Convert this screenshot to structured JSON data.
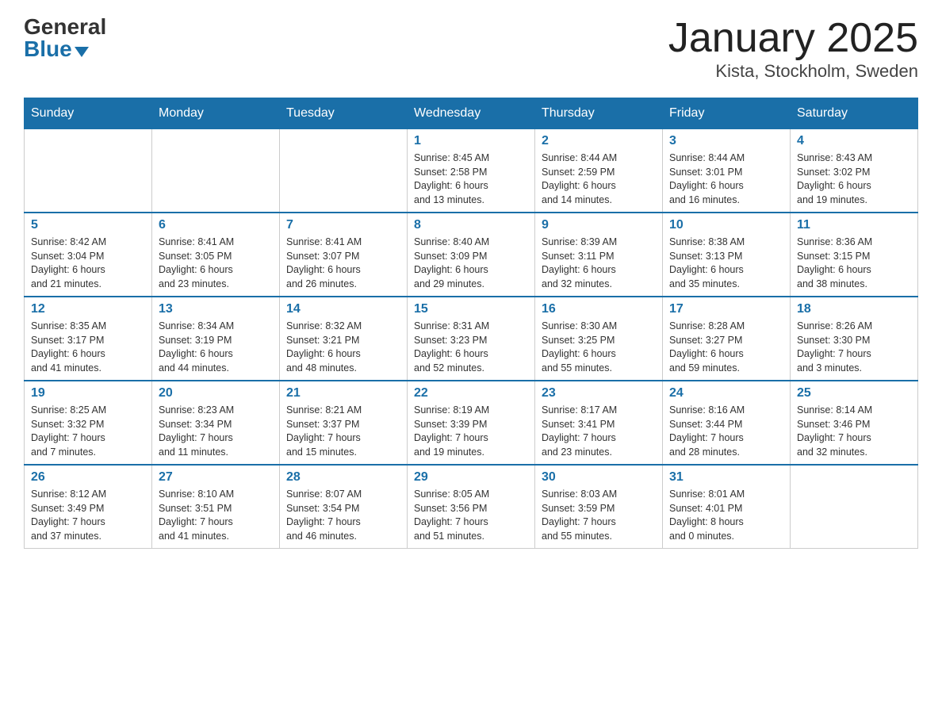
{
  "logo": {
    "general": "General",
    "blue": "Blue"
  },
  "header": {
    "month_year": "January 2025",
    "location": "Kista, Stockholm, Sweden"
  },
  "weekdays": [
    "Sunday",
    "Monday",
    "Tuesday",
    "Wednesday",
    "Thursday",
    "Friday",
    "Saturday"
  ],
  "weeks": [
    [
      {
        "day": "",
        "info": ""
      },
      {
        "day": "",
        "info": ""
      },
      {
        "day": "",
        "info": ""
      },
      {
        "day": "1",
        "info": "Sunrise: 8:45 AM\nSunset: 2:58 PM\nDaylight: 6 hours\nand 13 minutes."
      },
      {
        "day": "2",
        "info": "Sunrise: 8:44 AM\nSunset: 2:59 PM\nDaylight: 6 hours\nand 14 minutes."
      },
      {
        "day": "3",
        "info": "Sunrise: 8:44 AM\nSunset: 3:01 PM\nDaylight: 6 hours\nand 16 minutes."
      },
      {
        "day": "4",
        "info": "Sunrise: 8:43 AM\nSunset: 3:02 PM\nDaylight: 6 hours\nand 19 minutes."
      }
    ],
    [
      {
        "day": "5",
        "info": "Sunrise: 8:42 AM\nSunset: 3:04 PM\nDaylight: 6 hours\nand 21 minutes."
      },
      {
        "day": "6",
        "info": "Sunrise: 8:41 AM\nSunset: 3:05 PM\nDaylight: 6 hours\nand 23 minutes."
      },
      {
        "day": "7",
        "info": "Sunrise: 8:41 AM\nSunset: 3:07 PM\nDaylight: 6 hours\nand 26 minutes."
      },
      {
        "day": "8",
        "info": "Sunrise: 8:40 AM\nSunset: 3:09 PM\nDaylight: 6 hours\nand 29 minutes."
      },
      {
        "day": "9",
        "info": "Sunrise: 8:39 AM\nSunset: 3:11 PM\nDaylight: 6 hours\nand 32 minutes."
      },
      {
        "day": "10",
        "info": "Sunrise: 8:38 AM\nSunset: 3:13 PM\nDaylight: 6 hours\nand 35 minutes."
      },
      {
        "day": "11",
        "info": "Sunrise: 8:36 AM\nSunset: 3:15 PM\nDaylight: 6 hours\nand 38 minutes."
      }
    ],
    [
      {
        "day": "12",
        "info": "Sunrise: 8:35 AM\nSunset: 3:17 PM\nDaylight: 6 hours\nand 41 minutes."
      },
      {
        "day": "13",
        "info": "Sunrise: 8:34 AM\nSunset: 3:19 PM\nDaylight: 6 hours\nand 44 minutes."
      },
      {
        "day": "14",
        "info": "Sunrise: 8:32 AM\nSunset: 3:21 PM\nDaylight: 6 hours\nand 48 minutes."
      },
      {
        "day": "15",
        "info": "Sunrise: 8:31 AM\nSunset: 3:23 PM\nDaylight: 6 hours\nand 52 minutes."
      },
      {
        "day": "16",
        "info": "Sunrise: 8:30 AM\nSunset: 3:25 PM\nDaylight: 6 hours\nand 55 minutes."
      },
      {
        "day": "17",
        "info": "Sunrise: 8:28 AM\nSunset: 3:27 PM\nDaylight: 6 hours\nand 59 minutes."
      },
      {
        "day": "18",
        "info": "Sunrise: 8:26 AM\nSunset: 3:30 PM\nDaylight: 7 hours\nand 3 minutes."
      }
    ],
    [
      {
        "day": "19",
        "info": "Sunrise: 8:25 AM\nSunset: 3:32 PM\nDaylight: 7 hours\nand 7 minutes."
      },
      {
        "day": "20",
        "info": "Sunrise: 8:23 AM\nSunset: 3:34 PM\nDaylight: 7 hours\nand 11 minutes."
      },
      {
        "day": "21",
        "info": "Sunrise: 8:21 AM\nSunset: 3:37 PM\nDaylight: 7 hours\nand 15 minutes."
      },
      {
        "day": "22",
        "info": "Sunrise: 8:19 AM\nSunset: 3:39 PM\nDaylight: 7 hours\nand 19 minutes."
      },
      {
        "day": "23",
        "info": "Sunrise: 8:17 AM\nSunset: 3:41 PM\nDaylight: 7 hours\nand 23 minutes."
      },
      {
        "day": "24",
        "info": "Sunrise: 8:16 AM\nSunset: 3:44 PM\nDaylight: 7 hours\nand 28 minutes."
      },
      {
        "day": "25",
        "info": "Sunrise: 8:14 AM\nSunset: 3:46 PM\nDaylight: 7 hours\nand 32 minutes."
      }
    ],
    [
      {
        "day": "26",
        "info": "Sunrise: 8:12 AM\nSunset: 3:49 PM\nDaylight: 7 hours\nand 37 minutes."
      },
      {
        "day": "27",
        "info": "Sunrise: 8:10 AM\nSunset: 3:51 PM\nDaylight: 7 hours\nand 41 minutes."
      },
      {
        "day": "28",
        "info": "Sunrise: 8:07 AM\nSunset: 3:54 PM\nDaylight: 7 hours\nand 46 minutes."
      },
      {
        "day": "29",
        "info": "Sunrise: 8:05 AM\nSunset: 3:56 PM\nDaylight: 7 hours\nand 51 minutes."
      },
      {
        "day": "30",
        "info": "Sunrise: 8:03 AM\nSunset: 3:59 PM\nDaylight: 7 hours\nand 55 minutes."
      },
      {
        "day": "31",
        "info": "Sunrise: 8:01 AM\nSunset: 4:01 PM\nDaylight: 8 hours\nand 0 minutes."
      },
      {
        "day": "",
        "info": ""
      }
    ]
  ]
}
